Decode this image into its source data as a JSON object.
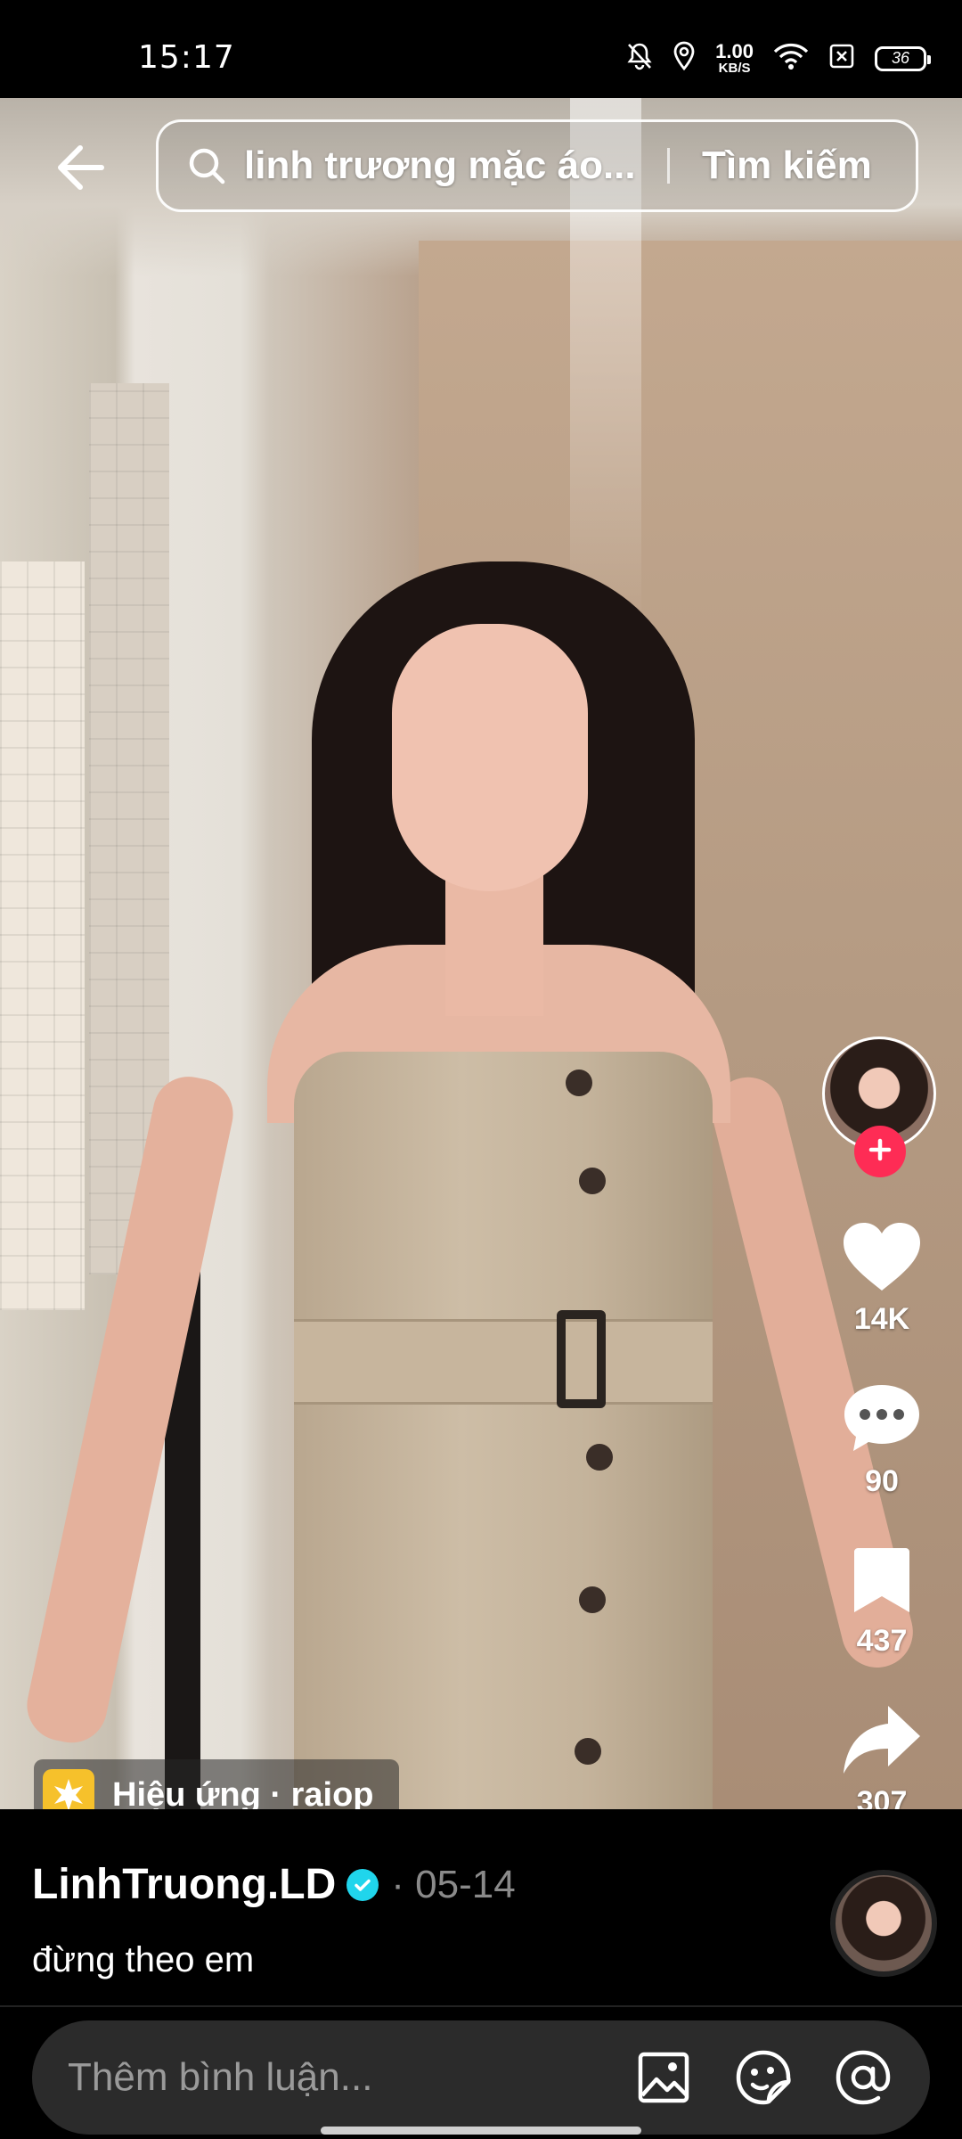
{
  "status_bar": {
    "time": "15:17",
    "net_speed_value": "1.00",
    "net_speed_unit": "KB/S",
    "battery": "36",
    "icons": [
      "bell-mute-icon",
      "location-icon",
      "wifi-icon",
      "sim-off-icon",
      "battery-icon"
    ]
  },
  "search": {
    "query": "linh trương mặc áo...",
    "button_label": "Tìm kiếm"
  },
  "actions": {
    "likes": "14K",
    "comments": "90",
    "saves": "437",
    "shares": "307"
  },
  "effect": {
    "label": "Hiệu ứng · raiop"
  },
  "post": {
    "username": "LinhTruong.LD",
    "date": "· 05-14",
    "caption": "đừng theo em"
  },
  "comment_bar": {
    "placeholder": "Thêm bình luận..."
  },
  "colors": {
    "follow_accent": "#fe2c55",
    "verified": "#20d5ec",
    "effect_icon": "#f6c12b"
  }
}
